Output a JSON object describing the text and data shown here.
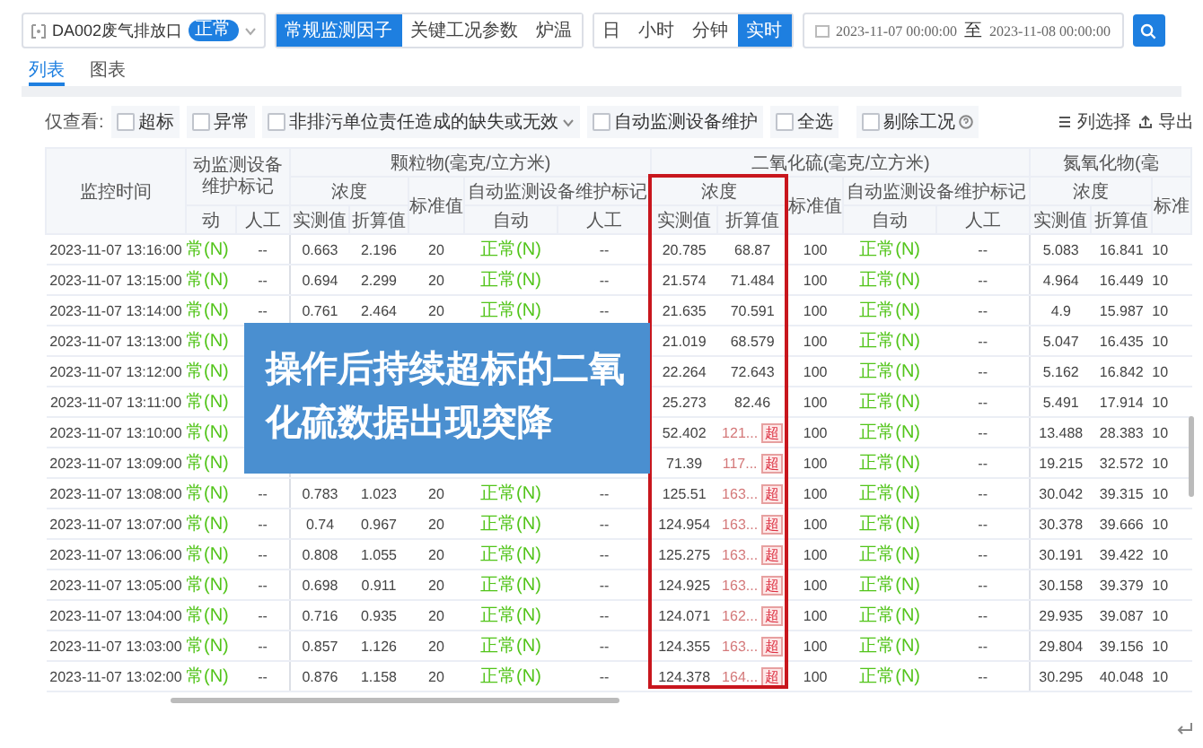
{
  "toolbar": {
    "outlet": "DA002废气排放口",
    "outlet_tag": "正常",
    "factor_buttons": [
      {
        "label": "常规监测因子",
        "selected": true
      },
      {
        "label": "关键工况参数",
        "selected": false
      },
      {
        "label": "炉温",
        "selected": false
      }
    ],
    "interval_buttons": [
      {
        "label": "日",
        "selected": false
      },
      {
        "label": "小时",
        "selected": false
      },
      {
        "label": "分钟",
        "selected": false
      },
      {
        "label": "实时",
        "selected": true
      }
    ],
    "date_from": "2023-11-07 00:00:00",
    "date_sep": "至",
    "date_to": "2023-11-08 00:00:00"
  },
  "tabs": [
    {
      "label": "列表",
      "selected": true
    },
    {
      "label": "图表",
      "selected": false
    }
  ],
  "filter": {
    "label": "仅查看:",
    "options": [
      {
        "label": "超标",
        "checked": false,
        "dropdown": false
      },
      {
        "label": "异常",
        "checked": false,
        "dropdown": false
      },
      {
        "label": "非排污单位责任造成的缺失或无效",
        "checked": false,
        "dropdown": true
      },
      {
        "label": "自动监测设备维护",
        "checked": false,
        "dropdown": false
      },
      {
        "label": "全选",
        "checked": false,
        "dropdown": false
      }
    ],
    "exclude": {
      "label": "剔除工况",
      "checked": false
    },
    "column_select": "列选择",
    "export": "导出"
  },
  "table": {
    "time_header": "监控时间",
    "maint_cut": {
      "title": "动监测设备维护标记",
      "auto": "动",
      "manual": "人工"
    },
    "pm": {
      "title": "颗粒物(毫克/立方米)",
      "concentration": "浓度",
      "measured": "实测值",
      "converted": "折算值",
      "standard": "标准值",
      "maintenance": "自动监测设备维护标记",
      "auto": "自动",
      "manual": "人工"
    },
    "so2": {
      "title": "二氧化硫(毫克/立方米)",
      "concentration": "浓度",
      "measured": "实测值",
      "converted": "折算值",
      "standard": "标准值",
      "maintenance": "自动监测设备维护标记",
      "auto": "自动",
      "manual": "人工"
    },
    "nox": {
      "title": "氮氧化物(毫",
      "concentration": "浓度",
      "measured": "实测值",
      "converted": "折算值",
      "standard": "标准"
    },
    "rows": [
      {
        "time": "2023-11-07 13:16:00",
        "maint_auto": "常(N)",
        "maint_manual": "--",
        "pm": {
          "measured": "0.663",
          "converted": "2.196",
          "standard": "20",
          "auto": "正常(N)",
          "manual": "--"
        },
        "so2": {
          "measured": "20.785",
          "converted": "68.87",
          "exceeded": false,
          "standard": "100",
          "auto": "正常(N)",
          "manual": "--"
        },
        "nox": {
          "measured": "5.083",
          "converted": "16.841",
          "standard": "10"
        }
      },
      {
        "time": "2023-11-07 13:15:00",
        "maint_auto": "常(N)",
        "maint_manual": "--",
        "pm": {
          "measured": "0.694",
          "converted": "2.299",
          "standard": "20",
          "auto": "正常(N)",
          "manual": "--"
        },
        "so2": {
          "measured": "21.574",
          "converted": "71.484",
          "exceeded": false,
          "standard": "100",
          "auto": "正常(N)",
          "manual": "--"
        },
        "nox": {
          "measured": "4.964",
          "converted": "16.449",
          "standard": "10"
        }
      },
      {
        "time": "2023-11-07 13:14:00",
        "maint_auto": "常(N)",
        "maint_manual": "--",
        "pm": {
          "measured": "0.761",
          "converted": "2.464",
          "standard": "20",
          "auto": "正常(N)",
          "manual": "--"
        },
        "so2": {
          "measured": "21.635",
          "converted": "70.591",
          "exceeded": false,
          "standard": "100",
          "auto": "正常(N)",
          "manual": "--"
        },
        "nox": {
          "measured": "4.9",
          "converted": "15.987",
          "standard": "10"
        }
      },
      {
        "time": "2023-11-07 13:13:00",
        "maint_auto": "常(N)",
        "so2": {
          "measured": "21.019",
          "converted": "68.579",
          "exceeded": false,
          "standard": "100",
          "auto": "正常(N)",
          "manual": "--"
        },
        "nox": {
          "measured": "5.047",
          "converted": "16.435",
          "standard": "10"
        }
      },
      {
        "time": "2023-11-07 13:12:00",
        "maint_auto": "常(N)",
        "so2": {
          "measured": "22.264",
          "converted": "72.643",
          "exceeded": false,
          "standard": "100",
          "auto": "正常(N)",
          "manual": "--"
        },
        "nox": {
          "measured": "5.162",
          "converted": "16.842",
          "standard": "10"
        }
      },
      {
        "time": "2023-11-07 13:11:00",
        "maint_auto": "常(N)",
        "so2": {
          "measured": "25.273",
          "converted": "82.46",
          "exceeded": false,
          "standard": "100",
          "auto": "正常(N)",
          "manual": "--"
        },
        "nox": {
          "measured": "5.491",
          "converted": "17.914",
          "standard": "10"
        }
      },
      {
        "time": "2023-11-07 13:10:00",
        "maint_auto": "常(N)",
        "so2": {
          "measured": "52.402",
          "converted": "121...",
          "exceeded": true,
          "badge": "超",
          "standard": "100",
          "auto": "正常(N)",
          "manual": "--"
        },
        "nox": {
          "measured": "13.488",
          "converted": "28.383",
          "standard": "10"
        }
      },
      {
        "time": "2023-11-07 13:09:00",
        "maint_auto": "常(N)",
        "so2": {
          "measured": "71.39",
          "converted": "117...",
          "exceeded": true,
          "badge": "超",
          "standard": "100",
          "auto": "正常(N)",
          "manual": "--"
        },
        "nox": {
          "measured": "19.215",
          "converted": "32.572",
          "standard": "10"
        }
      },
      {
        "time": "2023-11-07 13:08:00",
        "maint_auto": "常(N)",
        "maint_manual": "--",
        "pm": {
          "measured": "0.783",
          "converted": "1.023",
          "standard": "20",
          "auto": "正常(N)",
          "manual": "--"
        },
        "so2": {
          "measured": "125.51",
          "converted": "163...",
          "exceeded": true,
          "badge": "超",
          "standard": "100",
          "auto": "正常(N)",
          "manual": "--"
        },
        "nox": {
          "measured": "30.042",
          "converted": "39.315",
          "standard": "10"
        }
      },
      {
        "time": "2023-11-07 13:07:00",
        "maint_auto": "常(N)",
        "maint_manual": "--",
        "pm": {
          "measured": "0.74",
          "converted": "0.967",
          "standard": "20",
          "auto": "正常(N)",
          "manual": "--"
        },
        "so2": {
          "measured": "124.954",
          "converted": "163...",
          "exceeded": true,
          "badge": "超",
          "standard": "100",
          "auto": "正常(N)",
          "manual": "--"
        },
        "nox": {
          "measured": "30.378",
          "converted": "39.666",
          "standard": "10"
        }
      },
      {
        "time": "2023-11-07 13:06:00",
        "maint_auto": "常(N)",
        "maint_manual": "--",
        "pm": {
          "measured": "0.808",
          "converted": "1.055",
          "standard": "20",
          "auto": "正常(N)",
          "manual": "--"
        },
        "so2": {
          "measured": "125.275",
          "converted": "163...",
          "exceeded": true,
          "badge": "超",
          "standard": "100",
          "auto": "正常(N)",
          "manual": "--"
        },
        "nox": {
          "measured": "30.191",
          "converted": "39.422",
          "standard": "10"
        }
      },
      {
        "time": "2023-11-07 13:05:00",
        "maint_auto": "常(N)",
        "maint_manual": "--",
        "pm": {
          "measured": "0.698",
          "converted": "0.911",
          "standard": "20",
          "auto": "正常(N)",
          "manual": "--"
        },
        "so2": {
          "measured": "124.925",
          "converted": "163...",
          "exceeded": true,
          "badge": "超",
          "standard": "100",
          "auto": "正常(N)",
          "manual": "--"
        },
        "nox": {
          "measured": "30.158",
          "converted": "39.379",
          "standard": "10"
        }
      },
      {
        "time": "2023-11-07 13:04:00",
        "maint_auto": "常(N)",
        "maint_manual": "--",
        "pm": {
          "measured": "0.716",
          "converted": "0.935",
          "standard": "20",
          "auto": "正常(N)",
          "manual": "--"
        },
        "so2": {
          "measured": "124.071",
          "converted": "162...",
          "exceeded": true,
          "badge": "超",
          "standard": "100",
          "auto": "正常(N)",
          "manual": "--"
        },
        "nox": {
          "measured": "29.935",
          "converted": "39.087",
          "standard": "10"
        }
      },
      {
        "time": "2023-11-07 13:03:00",
        "maint_auto": "常(N)",
        "maint_manual": "--",
        "pm": {
          "measured": "0.857",
          "converted": "1.126",
          "standard": "20",
          "auto": "正常(N)",
          "manual": "--"
        },
        "so2": {
          "measured": "124.355",
          "converted": "163...",
          "exceeded": true,
          "badge": "超",
          "standard": "100",
          "auto": "正常(N)",
          "manual": "--"
        },
        "nox": {
          "measured": "29.804",
          "converted": "39.156",
          "standard": "10"
        }
      },
      {
        "time": "2023-11-07 13:02:00",
        "maint_auto": "常(N)",
        "maint_manual": "--",
        "pm": {
          "measured": "0.876",
          "converted": "1.158",
          "standard": "20",
          "auto": "正常(N)",
          "manual": "--"
        },
        "so2": {
          "measured": "124.378",
          "converted": "164...",
          "exceeded": true,
          "badge": "超",
          "standard": "100",
          "auto": "正常(N)",
          "manual": "--"
        },
        "nox": {
          "measured": "30.295",
          "converted": "40.048",
          "standard": "10"
        }
      }
    ]
  },
  "callout": "操作后持续超标的二氧化硫数据出现突降"
}
